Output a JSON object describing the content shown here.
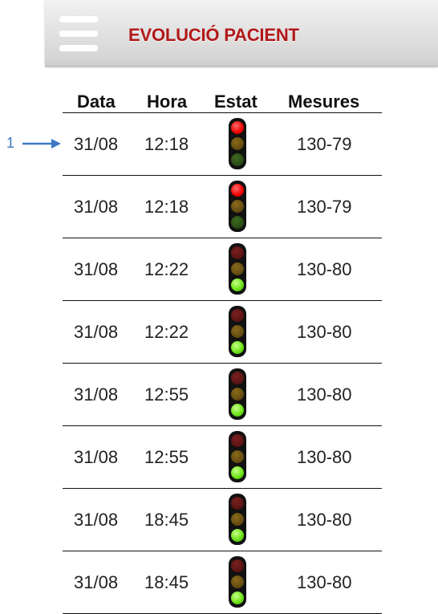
{
  "header": {
    "title": "EVOLUCIÓ PACIENT",
    "menu_icon": "hamburger-menu-icon"
  },
  "table": {
    "columns": [
      "Data",
      "Hora",
      "Estat",
      "Mesures"
    ],
    "rows": [
      {
        "date": "31/08",
        "time": "12:18",
        "status": "red",
        "measure": "130-79"
      },
      {
        "date": "31/08",
        "time": "12:18",
        "status": "red",
        "measure": "130-79"
      },
      {
        "date": "31/08",
        "time": "12:22",
        "status": "green",
        "measure": "130-80"
      },
      {
        "date": "31/08",
        "time": "12:22",
        "status": "green",
        "measure": "130-80"
      },
      {
        "date": "31/08",
        "time": "12:55",
        "status": "green",
        "measure": "130-80"
      },
      {
        "date": "31/08",
        "time": "12:55",
        "status": "green",
        "measure": "130-80"
      },
      {
        "date": "31/08",
        "time": "18:45",
        "status": "green",
        "measure": "130-80"
      },
      {
        "date": "31/08",
        "time": "18:45",
        "status": "green",
        "measure": "130-80"
      }
    ]
  },
  "annotation": {
    "label": "1",
    "color": "#3d78c2"
  },
  "colors": {
    "title": "#b2181a",
    "light_red": "#ee0000",
    "light_green": "#6fe31a"
  }
}
